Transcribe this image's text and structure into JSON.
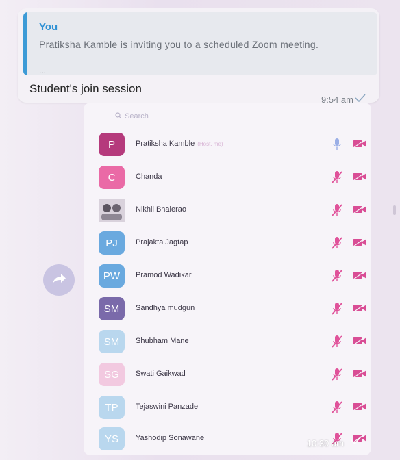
{
  "message": {
    "quote_author": "You",
    "quote_text": "Pratiksha Kamble is inviting you to a scheduled Zoom meeting.",
    "quote_more": "...",
    "caption": "Student's join session",
    "time": "9:54 am"
  },
  "screenshot": {
    "search_placeholder": "Search",
    "participants": [
      {
        "initials": "P",
        "name": "Pratiksha Kamble",
        "tag": "(Host, me)",
        "color": "#b53a7c"
      },
      {
        "initials": "C",
        "name": "Chanda",
        "color": "#ea6aa6"
      },
      {
        "initials": "",
        "name": "Nikhil Bhalerao",
        "color": "#c9c0cf",
        "photo": true
      },
      {
        "initials": "PJ",
        "name": "Prajakta Jagtap",
        "color": "#6aa9df"
      },
      {
        "initials": "PW",
        "name": "Pramod Wadikar",
        "color": "#6aa9df"
      },
      {
        "initials": "SM",
        "name": "Sandhya mudgun",
        "color": "#7a6aaa"
      },
      {
        "initials": "SM",
        "name": "Shubham Mane",
        "color": "#b9d7ee"
      },
      {
        "initials": "SG",
        "name": "Swati Gaikwad",
        "color": "#f2c9e0"
      },
      {
        "initials": "TP",
        "name": "Tejaswini Panzade",
        "color": "#b9d7ee"
      },
      {
        "initials": "YS",
        "name": "Yashodip Sonawane",
        "color": "#b9d7ee"
      }
    ],
    "time": "10:30 am"
  },
  "colors": {
    "accent": "#2f91d4",
    "mic_muted": "#e0529a",
    "cam_off": "#d94d95"
  }
}
